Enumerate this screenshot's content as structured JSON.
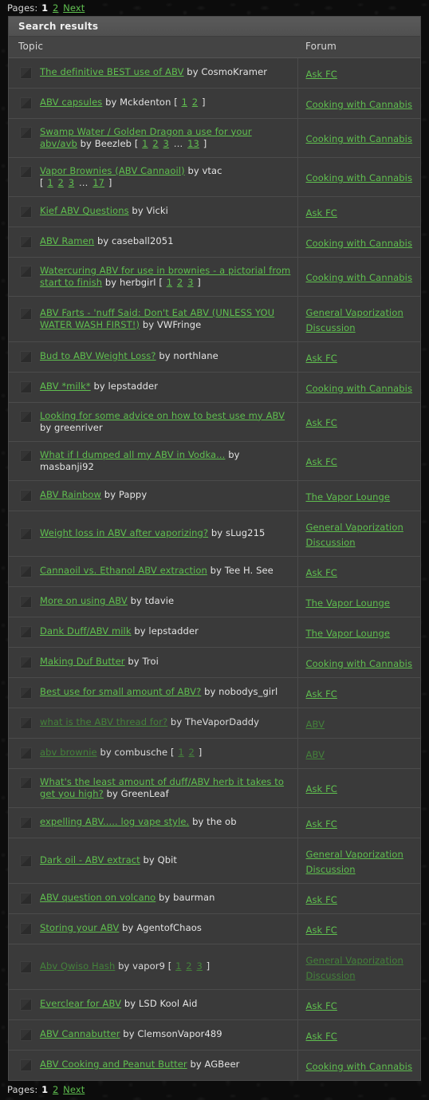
{
  "pager": {
    "label": "Pages:",
    "current": "1",
    "page2": "2",
    "next": "Next"
  },
  "panel": {
    "title": "Search results"
  },
  "columns": {
    "topic": "Topic",
    "forum": "Forum"
  },
  "icons": {
    "topic": "topic-thumbnail-icon"
  },
  "colors": {
    "link": "#5fbf4f",
    "link_dim": "#44823b",
    "text": "#e2e2e2",
    "panel_bg": "#3a3a3a",
    "header_bg": "#555555",
    "page_bg": "#0c0c0c"
  },
  "rows": [
    {
      "title": "The definitive BEST use of ABV",
      "by": "by CosmoKramer",
      "pages": [],
      "more": false,
      "forum": "Ask FC",
      "dim": false
    },
    {
      "title": "ABV capsules",
      "by": "by Mckdenton",
      "pages": [
        "1",
        "2"
      ],
      "more": false,
      "forum": "Cooking with Cannabis",
      "dim": false
    },
    {
      "title": "Swamp Water / Golden Dragon a use for your abv/avb",
      "by": "by Beezleb",
      "pages": [
        "1",
        "2",
        "3",
        "13"
      ],
      "more": true,
      "forum": "Cooking with Cannabis",
      "dim": false
    },
    {
      "title": "Vapor Brownies (ABV Cannaoil)",
      "by": "by vtac",
      "pages": [
        "1",
        "2",
        "3",
        "17"
      ],
      "more": true,
      "forum": "Cooking with Cannabis",
      "dim": false
    },
    {
      "title": "Kief ABV Questions",
      "by": "by Vicki",
      "pages": [],
      "more": false,
      "forum": "Ask FC",
      "dim": false
    },
    {
      "title": "ABV Ramen",
      "by": "by caseball2051",
      "pages": [],
      "more": false,
      "forum": "Cooking with Cannabis",
      "dim": false
    },
    {
      "title": "Watercuring ABV for use in brownies - a pictorial from start to finish",
      "by": "by herbgirl",
      "pages": [
        "1",
        "2",
        "3"
      ],
      "more": false,
      "forum": "Cooking with Cannabis",
      "dim": false
    },
    {
      "title": "ABV Farts - 'nuff Said: Don't Eat ABV (UNLESS YOU WATER WASH FIRST!)",
      "by": "by VWFringe",
      "pages": [],
      "more": false,
      "forum": "General Vaporization Discussion",
      "dim": false
    },
    {
      "title": "Bud to ABV Weight Loss?",
      "by": "by northlane",
      "pages": [],
      "more": false,
      "forum": "Ask FC",
      "dim": false
    },
    {
      "title": "ABV *milk*",
      "by": "by lepstadder",
      "pages": [],
      "more": false,
      "forum": "Cooking with Cannabis",
      "dim": false
    },
    {
      "title": "Looking for some advice on how to best use my ABV",
      "by": "by greenriver",
      "pages": [],
      "more": false,
      "forum": "Ask FC",
      "dim": false
    },
    {
      "title": "What if I dumped all my ABV in Vodka...",
      "by": "by masbanji92",
      "pages": [],
      "more": false,
      "forum": "Ask FC",
      "dim": false
    },
    {
      "title": "ABV Rainbow",
      "by": "by Pappy",
      "pages": [],
      "more": false,
      "forum": "The Vapor Lounge",
      "dim": false
    },
    {
      "title": "Weight loss in ABV after vaporizing?",
      "by": "by sLug215",
      "pages": [],
      "more": false,
      "forum": "General Vaporization Discussion",
      "dim": false
    },
    {
      "title": "Cannaoil vs. Ethanol ABV extraction",
      "by": "by Tee H. See",
      "pages": [],
      "more": false,
      "forum": "Ask FC",
      "dim": false
    },
    {
      "title": "More on using ABV",
      "by": "by tdavie",
      "pages": [],
      "more": false,
      "forum": "The Vapor Lounge",
      "dim": false
    },
    {
      "title": "Dank Duff/ABV milk",
      "by": "by lepstadder",
      "pages": [],
      "more": false,
      "forum": "The Vapor Lounge",
      "dim": false
    },
    {
      "title": "Making Duf Butter",
      "by": "by Troi",
      "pages": [],
      "more": false,
      "forum": "Cooking with Cannabis",
      "dim": false
    },
    {
      "title": "Best use for small amount of ABV?",
      "by": "by nobodys_girl",
      "pages": [],
      "more": false,
      "forum": "Ask FC",
      "dim": false
    },
    {
      "title": "what is the ABV thread for?",
      "by": "by TheVaporDaddy",
      "pages": [],
      "more": false,
      "forum": "ABV",
      "dim": true
    },
    {
      "title": "abv brownie",
      "by": "by combusche",
      "pages": [
        "1",
        "2"
      ],
      "more": false,
      "forum": "ABV",
      "dim": true
    },
    {
      "title": "What's the least amount of duff/ABV herb it takes to get you high?",
      "by": "by GreenLeaf",
      "pages": [],
      "more": false,
      "forum": "Ask FC",
      "dim": false
    },
    {
      "title": "expelling ABV..... log vape style.",
      "by": "by the ob",
      "pages": [],
      "more": false,
      "forum": "Ask FC",
      "dim": false
    },
    {
      "title": "Dark oil - ABV extract",
      "by": "by Qbit",
      "pages": [],
      "more": false,
      "forum": "General Vaporization Discussion",
      "dim": false
    },
    {
      "title": "ABV question on volcano",
      "by": "by baurman",
      "pages": [],
      "more": false,
      "forum": "Ask FC",
      "dim": false
    },
    {
      "title": "Storing your ABV",
      "by": "by AgentofChaos",
      "pages": [],
      "more": false,
      "forum": "Ask FC",
      "dim": false
    },
    {
      "title": "Abv Qwiso Hash",
      "by": "by vapor9",
      "pages": [
        "1",
        "2",
        "3"
      ],
      "more": false,
      "forum": "General Vaporization Discussion",
      "dim": true
    },
    {
      "title": "Everclear for ABV",
      "by": "by LSD Kool Aid",
      "pages": [],
      "more": false,
      "forum": "Ask FC",
      "dim": false
    },
    {
      "title": "ABV Cannabutter",
      "by": "by ClemsonVapor489",
      "pages": [],
      "more": false,
      "forum": "Ask FC",
      "dim": false
    },
    {
      "title": "ABV Cooking and Peanut Butter",
      "by": "by AGBeer",
      "pages": [],
      "more": false,
      "forum": "Cooking with Cannabis",
      "dim": false
    }
  ]
}
